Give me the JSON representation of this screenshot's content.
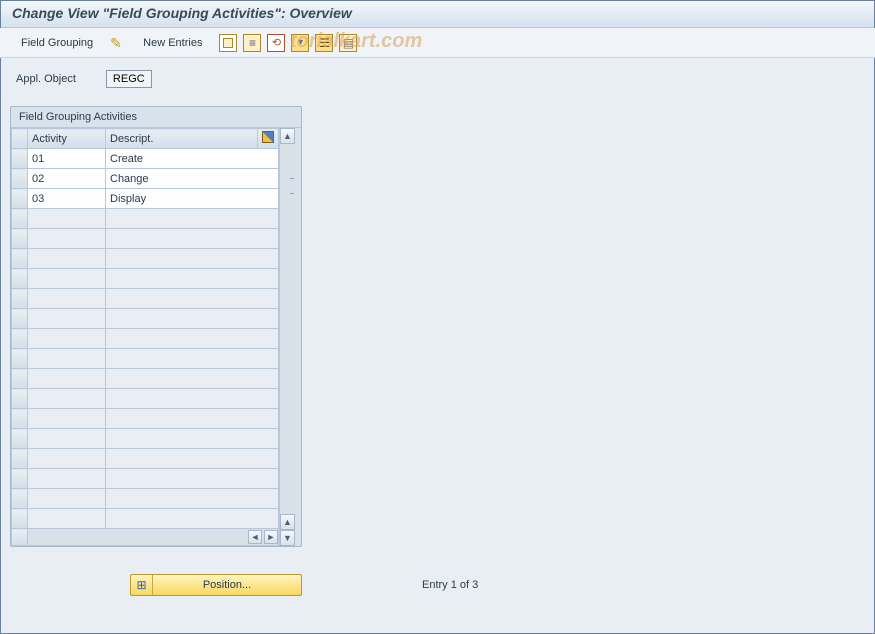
{
  "title": "Change View \"Field Grouping Activities\": Overview",
  "watermark": "torialkart.com",
  "toolbar": {
    "field_grouping_label": "Field Grouping",
    "new_entries_label": "New Entries"
  },
  "form": {
    "appl_object_label": "Appl. Object",
    "appl_object_value": "REGC"
  },
  "table": {
    "panel_title": "Field Grouping Activities",
    "col_activity": "Activity",
    "col_description": "Descript.",
    "rows": [
      {
        "activity": "01",
        "description": "Create"
      },
      {
        "activity": "02",
        "description": "Change"
      },
      {
        "activity": "03",
        "description": "Display"
      }
    ]
  },
  "footer": {
    "position_label": "Position...",
    "entry_text": "Entry 1 of 3"
  }
}
